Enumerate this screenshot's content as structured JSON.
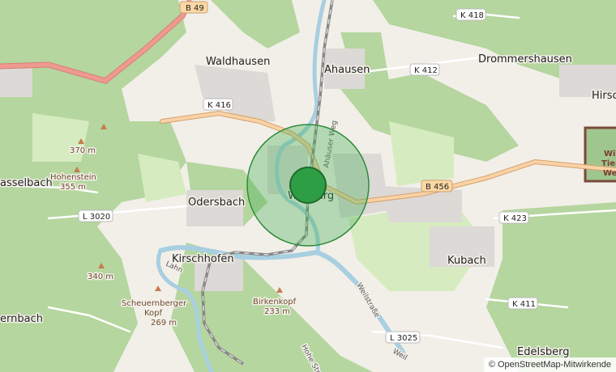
{
  "map": {
    "towns": [
      {
        "key": "waldhausen",
        "name": "Waldhausen"
      },
      {
        "key": "ahausen",
        "name": "Ahausen"
      },
      {
        "key": "drommershausen",
        "name": "Drommershausen"
      },
      {
        "key": "hirschhausen",
        "name": "Hirsch"
      },
      {
        "key": "odersbach",
        "name": "Odersbach"
      },
      {
        "key": "kirschhofen",
        "name": "Kirschhofen"
      },
      {
        "key": "kubach",
        "name": "Kubach"
      },
      {
        "key": "weilburg",
        "name": "Weilburg"
      },
      {
        "key": "edelsberg",
        "name": "Edelsberg"
      },
      {
        "key": "hasselbach",
        "name": "asselbach"
      },
      {
        "key": "ernbach",
        "name": "ernbach"
      }
    ],
    "road_shields": [
      {
        "key": "b49",
        "ref": "B 49"
      },
      {
        "key": "k418",
        "ref": "K 418"
      },
      {
        "key": "k412",
        "ref": "K 412"
      },
      {
        "key": "k416",
        "ref": "K 416"
      },
      {
        "key": "b456",
        "ref": "B 456"
      },
      {
        "key": "k423",
        "ref": "K 423"
      },
      {
        "key": "l3020",
        "ref": "L 3020"
      },
      {
        "key": "k411",
        "ref": "K 411"
      },
      {
        "key": "l3025",
        "ref": "L 3025"
      }
    ],
    "peaks": [
      {
        "key": "p370",
        "label": "370 m"
      },
      {
        "key": "hohenstein",
        "name": "Hohenstein",
        "label": "355 m"
      },
      {
        "key": "p340",
        "label": "340 m"
      },
      {
        "key": "scheuern",
        "name": "Scheuernberger",
        "name2": "Kopf",
        "label": "269 m"
      },
      {
        "key": "birkenkopf",
        "name": "Birkenkopf",
        "label": "233 m"
      }
    ],
    "streets": [
      {
        "key": "ahauser-weg",
        "name": "Ahäuser Weg"
      },
      {
        "key": "weilstrasse",
        "name": "Weilstraße"
      },
      {
        "key": "hohe-strasse",
        "name": "Hohe Straße"
      },
      {
        "key": "lahn",
        "name": "Lahn"
      },
      {
        "key": "weil",
        "name": "Weil"
      }
    ],
    "zoo_label_lines": [
      "Wi",
      "Tier",
      "We"
    ],
    "marker": {
      "title": "Weilburg"
    },
    "attribution": "© OpenStreetMap-Mitwirkende",
    "colors": {
      "land": "#f2efe9",
      "forest": "#b8d8a4",
      "forest_dark": "#add19e",
      "meadow": "#cdebb0",
      "residential": "#e0dfdf",
      "primary_road": "#f7c798",
      "highway": "#e8928a",
      "water": "#aad3df",
      "marker": "#2e9e45",
      "marker_ring": "#4cb85c"
    }
  }
}
